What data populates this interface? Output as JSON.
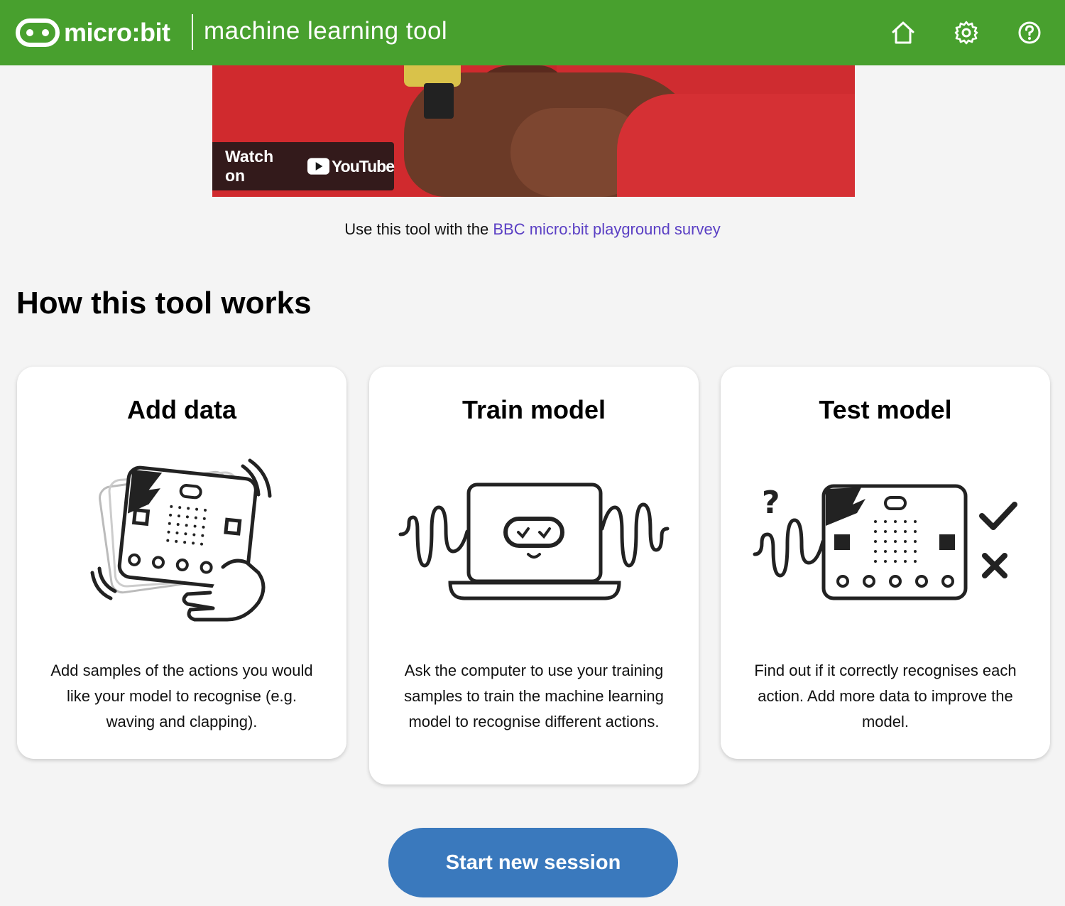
{
  "header": {
    "logo_text": "micro:bit",
    "title": "machine learning tool",
    "background_color": "#48a02e",
    "buttons": [
      {
        "icon": "home-icon"
      },
      {
        "icon": "gear-icon"
      },
      {
        "icon": "help-icon"
      }
    ]
  },
  "video": {
    "watch_on_label": "Watch on",
    "platform_label": "YouTube"
  },
  "survey": {
    "prefix": "Use this tool with the ",
    "link_text": "BBC micro:bit playground survey",
    "link_color": "#5a3fc4"
  },
  "section": {
    "title": "How this tool works"
  },
  "cards": [
    {
      "title": "Add data",
      "icon": "hand-shaking-microbit-icon",
      "text": "Add samples of the actions you would like your model to recognise (e.g. waving and clapping)."
    },
    {
      "title": "Train model",
      "icon": "laptop-with-waves-icon",
      "text": "Ask the computer to use your training samples to train the machine learning model to recognise different actions."
    },
    {
      "title": "Test model",
      "icon": "microbit-question-check-icon",
      "text": "Find out if it correctly recognises each action. Add more data to improve the model."
    }
  ],
  "start_button": {
    "label": "Start new session",
    "color": "#3a79bd"
  }
}
